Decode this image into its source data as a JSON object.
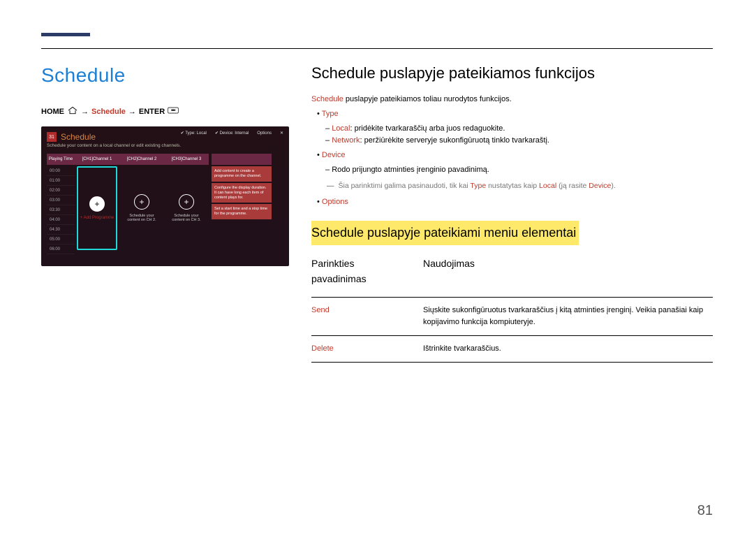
{
  "left": {
    "title": "Schedule",
    "breadcrumb": {
      "home": "HOME",
      "schedule": "Schedule",
      "enter": "ENTER"
    },
    "tv": {
      "calDay": "31",
      "title": "Schedule",
      "typeLabel": "Type: Local",
      "deviceLabel": "Device: Internal",
      "options": "Options",
      "close": "✕",
      "sub": "Schedule your content on a local channel or edit existing channels.",
      "colTime": "Playing Time",
      "times": [
        "00:00",
        "01:00",
        "02:00",
        "03:00",
        "03:30",
        "04:00",
        "04:30",
        "05:00",
        "06:00"
      ],
      "ch1": "[CH1]Channel 1",
      "ch2": "[CH2]Channel 2",
      "ch3": "[CH3]Channel 3",
      "addProg": "+ Add Programme",
      "sched2": "Schedule your content on CH 2.",
      "sched3": "Schedule your content on CH 3.",
      "info0": "",
      "info1": "Add content to create a programme on the channel.",
      "info2": "Configure the display duration. It can have long each item of content plays for.",
      "info3": "Set a start time and a stop time for the programme."
    }
  },
  "right": {
    "h1": "Schedule puslapyje pateikiamos funkcijos",
    "lead_a": "Schedule",
    "lead_b": " puslapyje pateikiamos toliau nurodytos funkcijos.",
    "type": "Type",
    "type_local_a": "Local",
    "type_local_b": ": pridėkite tvarkaraščių arba juos redaguokite.",
    "type_net_a": "Network",
    "type_net_b": ": peržiūrėkite serveryje sukonfigūruotą tinklo tvarkaraštį.",
    "device": "Device",
    "device_b": "Rodo prijungto atminties įrenginio pavadinimą.",
    "note_a": "Šia parinktimi galima pasinaudoti, tik kai ",
    "note_b": "Type",
    "note_c": " nustatytas kaip ",
    "note_d": "Local",
    "note_e": " (ją rasite ",
    "note_f": "Device",
    "note_g": ").",
    "options": "Options",
    "hl": "Schedule puslapyje pateikiami meniu elementai",
    "th1a": "Parinkties",
    "th1b": "pavadinimas",
    "th2": "Naudojimas",
    "rows": [
      {
        "name": "Send",
        "desc": "Siųskite sukonfigūruotus tvarkaraščius į kitą atminties įrenginį. Veikia panašiai kaip kopijavimo funkcija kompiuteryje."
      },
      {
        "name": "Delete",
        "desc": "Ištrinkite tvarkaraščius."
      }
    ]
  },
  "pageNumber": "81"
}
